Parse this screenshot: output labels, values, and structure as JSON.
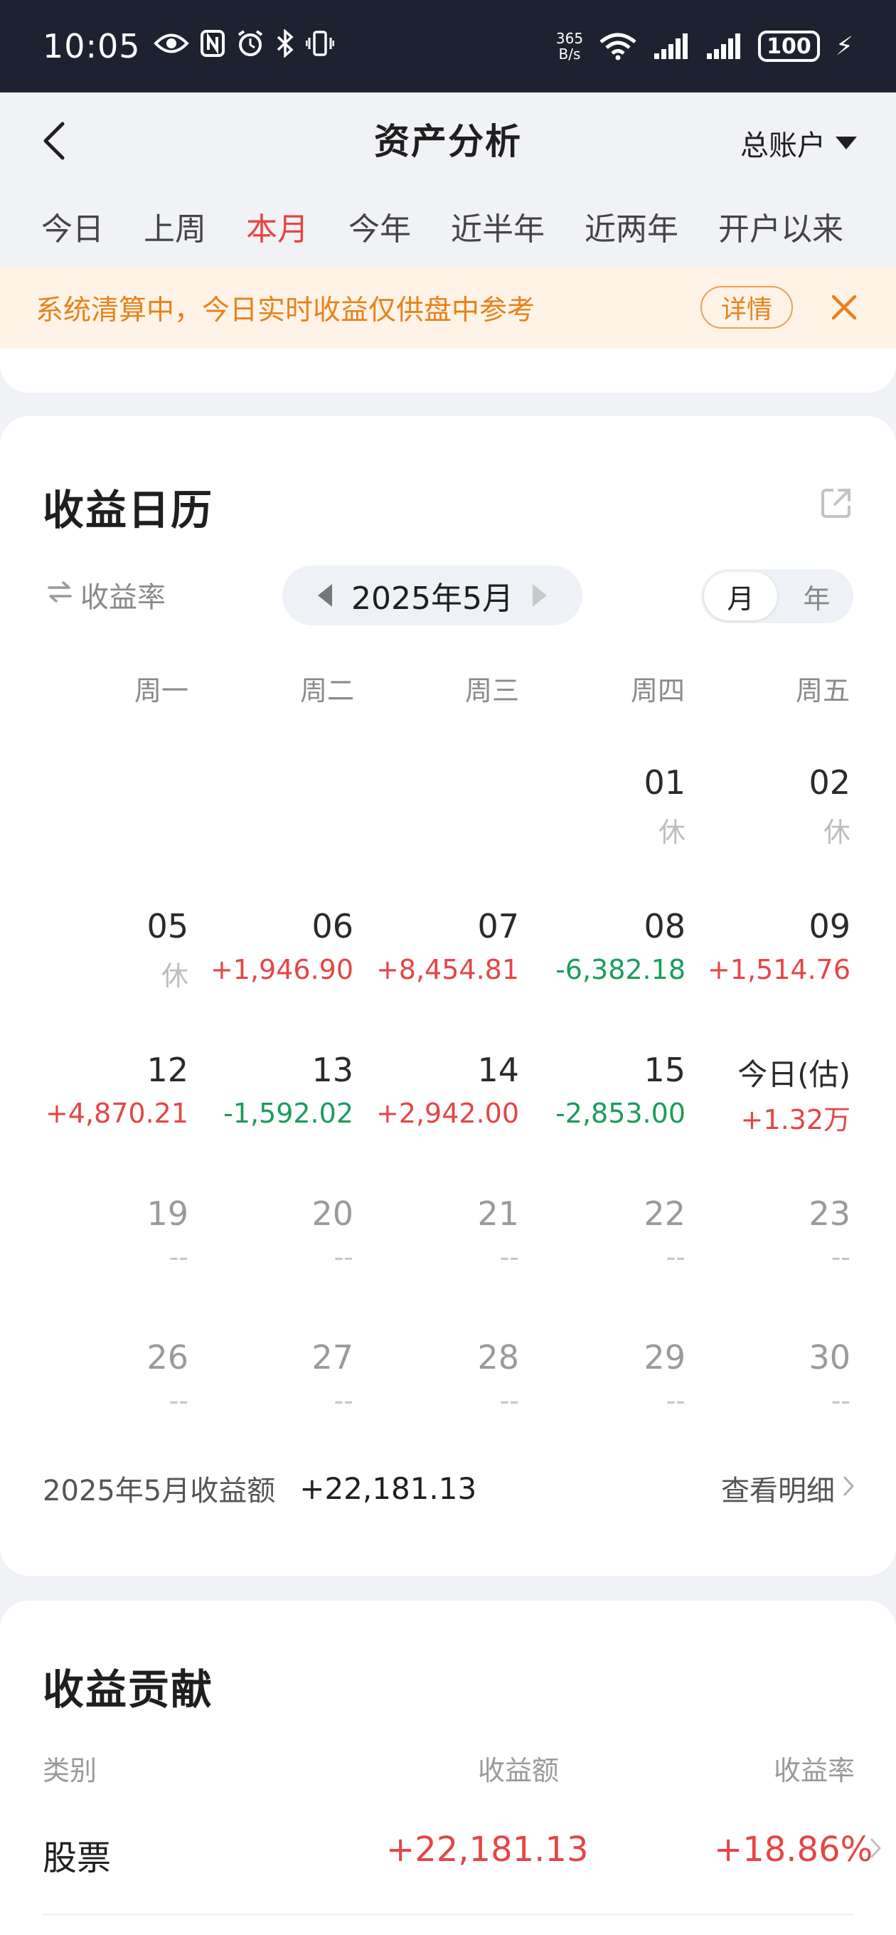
{
  "status": {
    "time": "10:05",
    "speed_top": "365",
    "speed_bottom": "B/s",
    "battery": "100"
  },
  "header": {
    "title": "资产分析",
    "account": "总账户"
  },
  "tabs": [
    "今日",
    "上周",
    "本月",
    "今年",
    "近半年",
    "近两年",
    "开户以来"
  ],
  "active_tab": "本月",
  "notice": {
    "text": "系统清算中，今日实时收益仅供盘中参考",
    "button": "详情"
  },
  "calendar": {
    "title": "收益日历",
    "rate_toggle": "收益率",
    "month": "2025年5月",
    "modes": [
      "月",
      "年"
    ],
    "weekdays": [
      "周一",
      "周二",
      "周三",
      "周四",
      "周五"
    ],
    "weeks": [
      [
        null,
        null,
        null,
        {
          "day": "01",
          "value": "休",
          "kind": "rest"
        },
        {
          "day": "02",
          "value": "休",
          "kind": "rest"
        }
      ],
      [
        {
          "day": "05",
          "value": "休",
          "kind": "rest"
        },
        {
          "day": "06",
          "value": "+1,946.90",
          "kind": "pos"
        },
        {
          "day": "07",
          "value": "+8,454.81",
          "kind": "pos"
        },
        {
          "day": "08",
          "value": "-6,382.18",
          "kind": "neg"
        },
        {
          "day": "09",
          "value": "+1,514.76",
          "kind": "pos"
        }
      ],
      [
        {
          "day": "12",
          "value": "+4,870.21",
          "kind": "pos"
        },
        {
          "day": "13",
          "value": "-1,592.02",
          "kind": "neg"
        },
        {
          "day": "14",
          "value": "+2,942.00",
          "kind": "pos"
        },
        {
          "day": "15",
          "value": "-2,853.00",
          "kind": "neg"
        },
        {
          "day": "今日(估)",
          "value": "+1.32万",
          "kind": "pos"
        }
      ],
      [
        {
          "day": "19",
          "value": "--",
          "kind": "none"
        },
        {
          "day": "20",
          "value": "--",
          "kind": "none"
        },
        {
          "day": "21",
          "value": "--",
          "kind": "none"
        },
        {
          "day": "22",
          "value": "--",
          "kind": "none"
        },
        {
          "day": "23",
          "value": "--",
          "kind": "none"
        }
      ],
      [
        {
          "day": "26",
          "value": "--",
          "kind": "none"
        },
        {
          "day": "27",
          "value": "--",
          "kind": "none"
        },
        {
          "day": "28",
          "value": "--",
          "kind": "none"
        },
        {
          "day": "29",
          "value": "--",
          "kind": "none"
        },
        {
          "day": "30",
          "value": "--",
          "kind": "none"
        }
      ]
    ],
    "summary_label": "2025年5月收益额",
    "summary_value": "+22,181.13",
    "details_link": "查看明细"
  },
  "contribution": {
    "title": "收益贡献",
    "headers": [
      "类别",
      "收益额",
      "收益率"
    ],
    "rows": [
      {
        "category": "股票",
        "amount": "+22,181.13",
        "rate": "+18.86%"
      }
    ]
  },
  "colors": {
    "positive": "#e64545",
    "negative": "#1a9d5b",
    "notice": "#e8821c"
  }
}
